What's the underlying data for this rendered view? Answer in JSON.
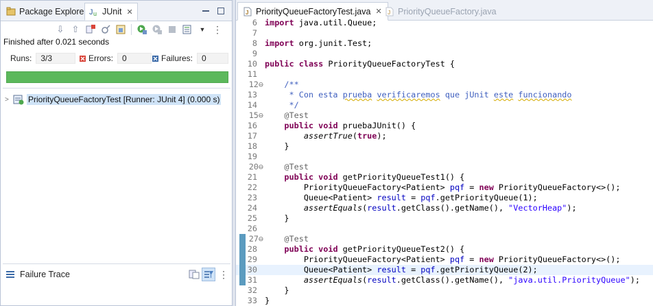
{
  "left_panel": {
    "tabs": [
      {
        "label": "Package Explorer",
        "icon": "package-explorer-icon",
        "active": false
      },
      {
        "label": "JUnit",
        "icon": "junit-icon",
        "active": true
      }
    ],
    "status": "Finished after 0.021 seconds",
    "runs_label": "Runs:",
    "runs_value": "3/3",
    "errors_label": "Errors:",
    "errors_value": "0",
    "failures_label": "Failures:",
    "failures_value": "0",
    "progress_fraction": 1.0,
    "progress_color": "#5cb85c",
    "tree_item": "PriorityQueueFactoryTest [Runner: JUnit 4] (0.000 s)",
    "failure_trace_label": "Failure Trace"
  },
  "editor": {
    "tabs": [
      {
        "label": "PriorityQueueFactoryTest.java",
        "active": true
      },
      {
        "label": "PriorityQueueFactory.java",
        "active": false
      }
    ],
    "lines": [
      {
        "n": "6",
        "text": "import java.util.Queue;"
      },
      {
        "n": "7",
        "text": ""
      },
      {
        "n": "8",
        "text": "import org.junit.Test;"
      },
      {
        "n": "9",
        "text": ""
      },
      {
        "n": "10",
        "text": "public class PriorityQueueFactoryTest {"
      },
      {
        "n": "11",
        "text": ""
      },
      {
        "n": "12",
        "text": "    /**",
        "fold": true
      },
      {
        "n": "13",
        "text": "     * Con esta prueba verificaremos que jUnit este funcionando"
      },
      {
        "n": "14",
        "text": "     */"
      },
      {
        "n": "15",
        "text": "    @Test",
        "fold": true
      },
      {
        "n": "16",
        "text": "    public void pruebaJUnit() {"
      },
      {
        "n": "17",
        "text": "        assertTrue(true);"
      },
      {
        "n": "18",
        "text": "    }"
      },
      {
        "n": "19",
        "text": ""
      },
      {
        "n": "20",
        "text": "    @Test",
        "fold": true
      },
      {
        "n": "21",
        "text": "    public void getPriorityQueueTest1() {"
      },
      {
        "n": "22",
        "text": "        PriorityQueueFactory<Patient> pqf = new PriorityQueueFactory<>();"
      },
      {
        "n": "23",
        "text": "        Queue<Patient> result = pqf.getPriorityQueue(1);"
      },
      {
        "n": "24",
        "text": "        assertEquals(result.getClass().getName(), \"VectorHeap\");"
      },
      {
        "n": "25",
        "text": "    }"
      },
      {
        "n": "26",
        "text": ""
      },
      {
        "n": "27",
        "text": "    @Test",
        "fold": true
      },
      {
        "n": "28",
        "text": "    public void getPriorityQueueTest2() {"
      },
      {
        "n": "29",
        "text": "        PriorityQueueFactory<Patient> pqf = new PriorityQueueFactory<>();"
      },
      {
        "n": "30",
        "text": "        Queue<Patient> result = pqf.getPriorityQueue(2);"
      },
      {
        "n": "31",
        "text": "        assertEquals(result.getClass().getName(), \"java.util.PriorityQueue\");"
      },
      {
        "n": "32",
        "text": "    }"
      },
      {
        "n": "33",
        "text": "}"
      }
    ],
    "highlighted_line": "30",
    "colors": {
      "keyword": "#7f0055",
      "comment": "#3f5fbf",
      "annotation": "#646464",
      "string": "#2a00ff",
      "current_line": "#e8f2fe"
    }
  }
}
